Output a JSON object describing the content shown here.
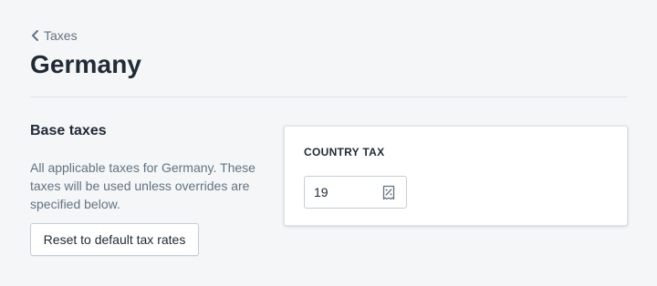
{
  "breadcrumb": {
    "label": "Taxes"
  },
  "page": {
    "title": "Germany"
  },
  "base_taxes": {
    "title": "Base taxes",
    "description": "All applicable taxes for Germany. These taxes will be used unless overrides are specified below.",
    "reset_label": "Reset to default tax rates"
  },
  "country_tax": {
    "label": "COUNTRY TAX",
    "value": "19",
    "suffix_icon": "percent-receipt-icon"
  },
  "colors": {
    "background": "#f4f6f8",
    "text_primary": "#212b36",
    "text_secondary": "#637381",
    "border": "#c4cdd5"
  }
}
